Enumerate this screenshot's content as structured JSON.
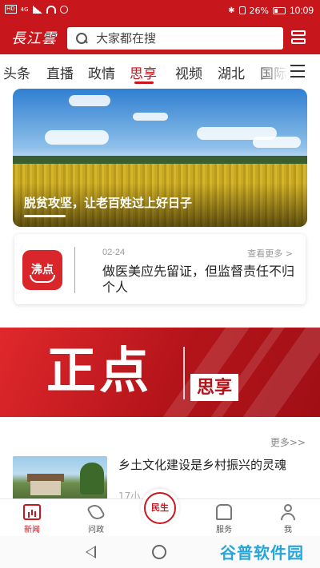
{
  "status_bar": {
    "network": "4G",
    "battery": "26%",
    "time": "10:09"
  },
  "header": {
    "logo_text": "長江雲",
    "search": {
      "placeholder": "大家都在搜"
    }
  },
  "tabs": [
    {
      "label": "头条"
    },
    {
      "label": "直播"
    },
    {
      "label": "政情"
    },
    {
      "label": "思享",
      "active": true
    },
    {
      "label": "视频"
    },
    {
      "label": "湖北"
    },
    {
      "label": "国际"
    }
  ],
  "hero": {
    "title": "脱贫攻坚，让老百姓过上好日子"
  },
  "news_flash": {
    "logo_label": "沸点",
    "date": "02-24",
    "more_label": "查看更多 >",
    "headline": "做医美应先留证，但监督责任不归个人"
  },
  "banner": {
    "main_text": "正点",
    "tag_text": "思享"
  },
  "article_list": {
    "more_label": "更多>>",
    "items": [
      {
        "title": "乡土文化建设是乡村振兴的灵魂",
        "meta": "17小"
      }
    ]
  },
  "bottom_nav": {
    "items": [
      {
        "label": "新闻",
        "icon": "news-chart-icon",
        "active": true
      },
      {
        "label": "问政",
        "icon": "phone-icon"
      },
      {
        "label": "服务",
        "icon": "service-icon"
      },
      {
        "label": "我",
        "icon": "user-icon"
      }
    ],
    "center": {
      "label": "民生"
    }
  },
  "watermark": {
    "text": "谷普软件园"
  },
  "colors": {
    "brand_red": "#c8161d",
    "watermark_blue": "#2aa5d8"
  }
}
